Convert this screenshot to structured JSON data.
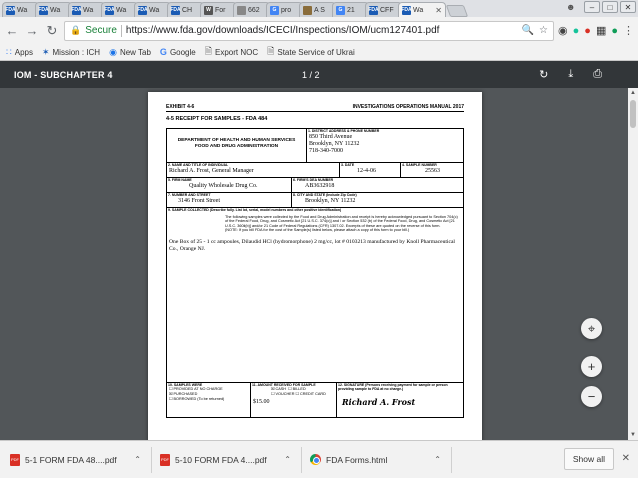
{
  "tabs": [
    {
      "label": "Wa",
      "favicon": "FDA",
      "color": "#1a5bb4"
    },
    {
      "label": "Wa",
      "favicon": "FDA",
      "color": "#1a5bb4"
    },
    {
      "label": "Wa",
      "favicon": "FDA",
      "color": "#1a5bb4"
    },
    {
      "label": "Wa",
      "favicon": "FDA",
      "color": "#1a5bb4"
    },
    {
      "label": "Wa",
      "favicon": "FDA",
      "color": "#1a5bb4"
    },
    {
      "label": "CH",
      "favicon": "FDA",
      "color": "#1a5bb4"
    },
    {
      "label": "For",
      "favicon": "W",
      "color": "#555555"
    },
    {
      "label": "662",
      "favicon": "doc",
      "color": "#888888"
    },
    {
      "label": "pro",
      "favicon": "G",
      "color": "#4285f4"
    },
    {
      "label": "A S",
      "favicon": "img",
      "color": "#8a6d3b"
    },
    {
      "label": "21",
      "favicon": "G",
      "color": "#4285f4"
    },
    {
      "label": "CFF",
      "favicon": "FDA",
      "color": "#1a5bb4"
    }
  ],
  "active_tab": {
    "label": "Wa",
    "favicon": "FDA"
  },
  "address": {
    "secure_label": "Secure",
    "url": "https://www.fda.gov/downloads/ICECI/Inspections/IOM/ucm127401.pdf"
  },
  "bookmarks": [
    {
      "label": "Apps",
      "icon": "apps-grid-icon"
    },
    {
      "label": "Mission : ICH",
      "icon": "star-icon"
    },
    {
      "label": "New Tab",
      "icon": "globe-icon"
    },
    {
      "label": "Google",
      "icon": "google-icon"
    },
    {
      "label": "Export NOC",
      "icon": "page-icon"
    },
    {
      "label": "State Service of Ukrai",
      "icon": "page-icon"
    }
  ],
  "pdf": {
    "title": "IOM - SUBCHAPTER 4",
    "page_indicator": "1 / 2"
  },
  "form": {
    "exhibit": "EXHIBIT 4-6",
    "manual": "INVESTIGATIONS OPERATIONS MANUAL 2017",
    "heading": "4-5 RECEIPT FOR SAMPLES - FDA 484",
    "dept_line1": "DEPARTMENT OF HEALTH AND HUMAN SERVICES",
    "dept_line2": "FOOD AND DRUG ADMINISTRATION",
    "lbl_district": "1. DISTRICT ADDRESS & PHONE NUMBER",
    "district_line1": "850 Third Avenue",
    "district_line2": "Brooklyn, NY 11232",
    "district_line3": "718-340-7000",
    "lbl_name": "2. NAME AND TITLE OF INDIVIDUAL",
    "name_value": "Richard A. Frost, General Manager",
    "lbl_date": "3. DATE",
    "date_value": "12-4-06",
    "lbl_sample": "4. SAMPLE NUMBER",
    "sample_value": "25563",
    "lbl_firm": "5. FIRM NAME",
    "firm_value": "Quality Wholesale Drug Co.",
    "lbl_fei": "6. FIRM'S DEA NUMBER",
    "fei_value": "AB3632918",
    "lbl_street": "7. NUMBER AND STREET",
    "street_value": "3146 Front Street",
    "lbl_city": "8. CITY AND STATE (Include Zip Code)",
    "city_value": "Brooklyn, NY 11232",
    "lbl_collected": "9. SAMPLE COLLECTED (Describe fully. List lot, serial, model numbers and other positive identification)",
    "statement": "The following samples were collected by the Food and Drug Administration and receipt is hereby acknowledged pursuant to Section 704(c) of the Federal Food, Drug, and Cosmetic Act [21 U.S.C. 374(c)] and / or Section 532 (b) of the Federal Food, Drug, and Cosmetic Act [21 U.S.C. 360ii(b)] and/or 21 Code of Federal Regulations (CFR) 1307.02. Excerpts of these are quoted on the reverse of this form.",
    "statement_note": "(NOTE: If you bill FDA for the cost of the Sample(s) listed below, please attach a copy of this form to your bill.)",
    "description": "One Box of 25 - 1 cc ampoules, Dilaudid HCl (hydromorphone) 2 mg/cc, lot # 0103213 manufactured by Knoll Pharmaceutical Co., Orange NJ.",
    "lbl_samples_were": "10. SAMPLES WERE",
    "opt_provided": "PROVIDED AT NO CHARGE",
    "opt_purchased": "PURCHASED",
    "opt_borrowed": "BORROWED (To be returned)",
    "lbl_amount": "11. AMOUNT RECEIVED FOR SAMPLE",
    "opt_cash": "CASH",
    "opt_billed": "BILLED",
    "opt_voucher": "VOUCHER",
    "opt_credit": "CREDIT CARD",
    "amount_value": "$15.00",
    "lbl_signature": "12. SIGNATURE (Persons receiving payment for sample or person providing sample to FDA at no charge.)",
    "signature": "Richard A. Frost"
  },
  "downloads": [
    {
      "label": "5-1 FORM FDA 48....pdf",
      "icon": "pdf-file-icon"
    },
    {
      "label": "5-10 FORM FDA 4....pdf",
      "icon": "pdf-file-icon"
    },
    {
      "label": "FDA Forms.html",
      "icon": "chrome-icon"
    }
  ],
  "show_all_label": "Show all"
}
